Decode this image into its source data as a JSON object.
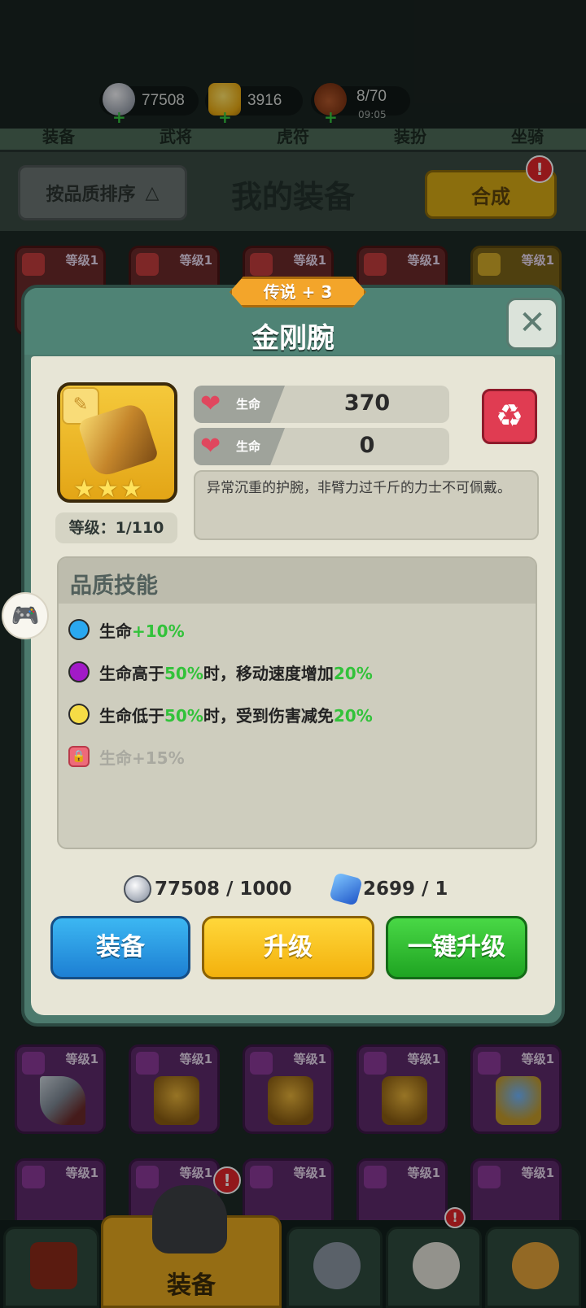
{
  "resources": {
    "silver": "77508",
    "gold": "3916",
    "stamina": "8/70",
    "stamina_timer": "09:05",
    "plus": "+"
  },
  "tabs": [
    "装备",
    "武将",
    "虎符",
    "装扮",
    "坐骑"
  ],
  "header": {
    "sort_label": "按品质排序",
    "sort_arrow": "△",
    "title": "我的装备",
    "merge_label": "合成",
    "merge_badge": "!"
  },
  "grid": {
    "slot_level": "等级1"
  },
  "bottom_nav": {
    "active_label": "装备",
    "badge": "!"
  },
  "modal": {
    "rarity": "传说 + 3",
    "title": "金刚腕",
    "close": "✕",
    "item_tag": "✎",
    "stars": [
      "★",
      "★",
      "★"
    ],
    "level": "等级：1/110",
    "stats": [
      {
        "name": "生命",
        "value": "370"
      },
      {
        "name": "生命",
        "value": "0"
      }
    ],
    "recycle": "♻",
    "description": "异常沉重的护腕，非臂力过千斤的力士不可佩戴。",
    "skills_title": "品质技能",
    "skills": [
      {
        "color": "#2aa8f0",
        "parts": [
          "生命",
          "+10%",
          "",
          "",
          ""
        ]
      },
      {
        "color": "#a21ac7",
        "parts": [
          "生命高于",
          "50%",
          "时，移动速度增加",
          "20%",
          ""
        ]
      },
      {
        "color": "#f6dc46",
        "parts": [
          "生命低于",
          "50%",
          "时，受到伤害减免",
          "20%",
          ""
        ]
      }
    ],
    "locked_skill": "生命+15%",
    "costs": {
      "silver": "77508 / 1000",
      "gem": "2699 / 1"
    },
    "buttons": {
      "equip": "装备",
      "upgrade": "升级",
      "one_key": "一键升级"
    }
  }
}
